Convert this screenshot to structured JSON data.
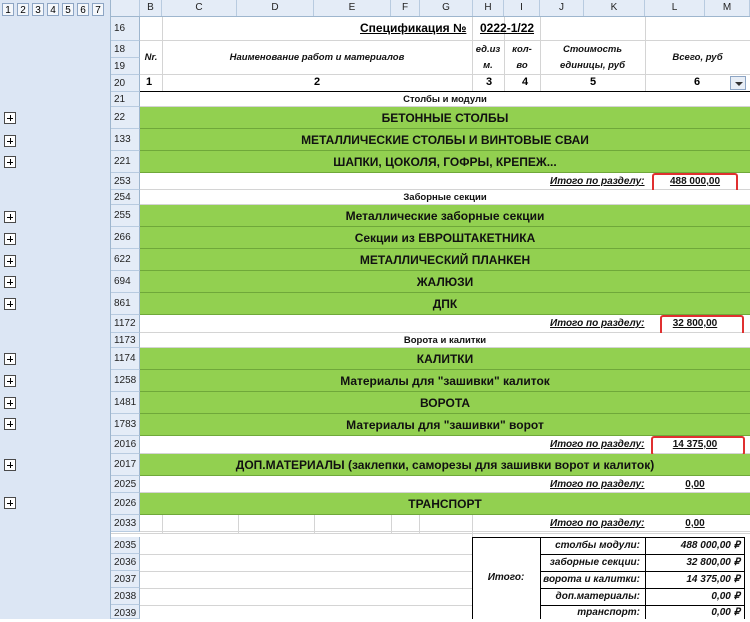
{
  "outline_levels": [
    "1",
    "2",
    "3",
    "4",
    "5",
    "6",
    "7"
  ],
  "columns": [
    "B",
    "C",
    "D",
    "E",
    "F",
    "G",
    "H",
    "I",
    "J",
    "K",
    "L",
    "M"
  ],
  "row_numbers": [
    "16",
    "18",
    "19",
    "20",
    "21",
    "22",
    "133",
    "221",
    "253",
    "254",
    "255",
    "266",
    "622",
    "694",
    "861",
    "1172",
    "1173",
    "1174",
    "1258",
    "1481",
    "1783",
    "2016",
    "2017",
    "2025",
    "2026",
    "2033",
    "2035",
    "2036",
    "2037",
    "2038",
    "2039"
  ],
  "spec": {
    "title": "Спецификация №",
    "number": "0222-1/22"
  },
  "table_header": {
    "nr": "Nr.",
    "name": "Наименование работ и материалов",
    "unit_1": "ед.из",
    "unit_2": "м.",
    "qty_1": "кол-",
    "qty_2": "во",
    "cost_1": "Стоимость",
    "cost_2": "единицы, руб",
    "total": "Всего, руб",
    "n1": "1",
    "n2": "2",
    "n3": "3",
    "n4": "4",
    "n5": "5",
    "n6": "6"
  },
  "sections": {
    "s1": "Столбы и модули",
    "s2": "Заборные секции",
    "s3": "Ворота и калитки"
  },
  "groups": {
    "g22": "БЕТОННЫЕ СТОЛБЫ",
    "g133": "МЕТАЛЛИЧЕСКИЕ СТОЛБЫ И ВИНТОВЫЕ СВАИ",
    "g221": "ШАПКИ, ЦОКОЛЯ, ГОФРЫ, КРЕПЕЖ...",
    "g255": "Металлические заборные секции",
    "g266": "Секции из ЕВРОШТАКЕТНИКА",
    "g622": "МЕТАЛЛИЧЕСКИЙ ПЛАНКЕН",
    "g694": "ЖАЛЮЗИ",
    "g861": "ДПК",
    "g1174": "КАЛИТКИ",
    "g1258": "Материалы для \"зашивки\" калиток",
    "g1481": "ВОРОТА",
    "g1783": "Материалы для \"зашивки\" ворот",
    "g2017": "ДОП.МАТЕРИАЛЫ (заклепки, саморезы для зашивки ворот и калиток)",
    "g2026": "ТРАНСПОРТ"
  },
  "subtotal_label": "Итого по разделу:",
  "subtotals": {
    "r253": "488 000,00",
    "r1172": "32 800,00",
    "r2016": "14 375,00",
    "r2025": "0,00",
    "r2033": "0,00"
  },
  "summary": {
    "label": "Итого:",
    "items": [
      {
        "label": "столбы модули:",
        "value": "488 000,00 ₽"
      },
      {
        "label": "заборные секции:",
        "value": "32 800,00 ₽"
      },
      {
        "label": "ворота и калитки:",
        "value": "14 375,00 ₽"
      },
      {
        "label": "доп.материалы:",
        "value": "0,00 ₽"
      },
      {
        "label": "транспорт:",
        "value": "0,00 ₽"
      }
    ]
  },
  "colors": {
    "group_fill": "#92d050",
    "highlight": "#e03030",
    "header_fill": "#e4ecf7"
  }
}
